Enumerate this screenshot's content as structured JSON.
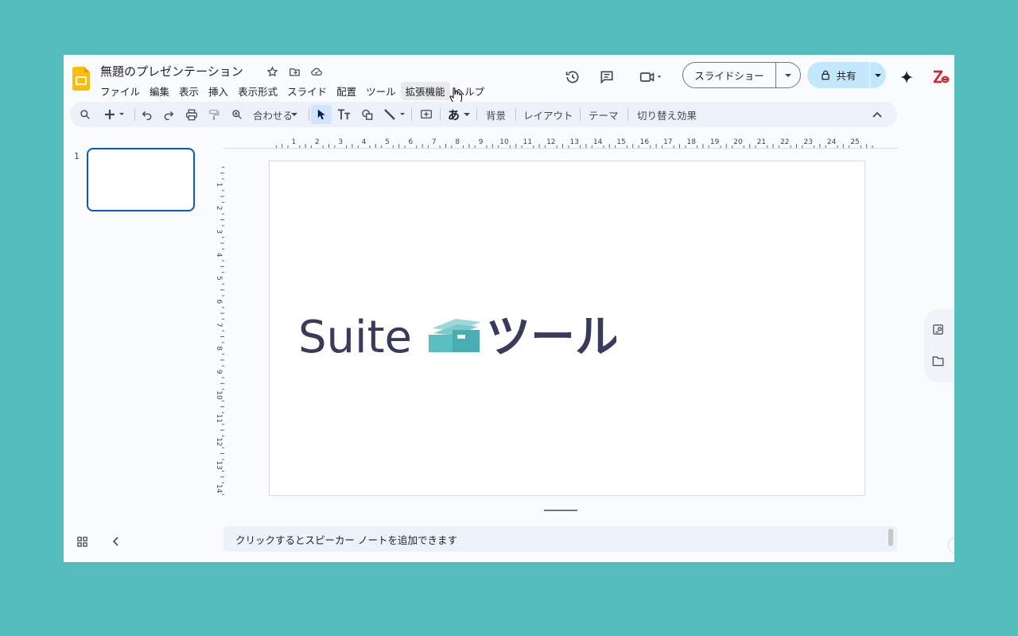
{
  "document": {
    "title": "無題のプレゼンテーション"
  },
  "menu": [
    "ファイル",
    "編集",
    "表示",
    "挿入",
    "表示形式",
    "スライド",
    "配置",
    "ツール",
    "拡張機能",
    "ヘルプ"
  ],
  "header": {
    "slideshow_label": "スライドショー",
    "share_label": "共有"
  },
  "toolbar": {
    "zoom_label": "合わせる",
    "font_input_label": "あ",
    "background_label": "背景",
    "layout_label": "レイアウト",
    "theme_label": "テーマ",
    "transition_label": "切り替え効果"
  },
  "filmstrip": {
    "slide_number": "1"
  },
  "rulers": {
    "horizontal": [
      "1",
      "2",
      "3",
      "4",
      "5",
      "6",
      "7",
      "8",
      "9",
      "10",
      "11",
      "12",
      "13",
      "14",
      "15",
      "16",
      "17",
      "18",
      "19",
      "20",
      "21",
      "22",
      "23",
      "24",
      "25"
    ],
    "vertical": [
      "1",
      "2",
      "3",
      "4",
      "5",
      "6",
      "7",
      "8",
      "9",
      "10",
      "11",
      "12",
      "13",
      "14"
    ]
  },
  "slide": {
    "logo_text_latin": "Suite",
    "logo_text_japanese": "ツール"
  },
  "notes": {
    "placeholder": "クリックするとスピーカー ノートを追加できます"
  },
  "colors": {
    "background": "#56bdbf",
    "logo_dark": "#3a3a5c",
    "logo_teal": "#5bbfc2",
    "share_button": "#c2e7ff",
    "selection_border": "#0b57d0"
  }
}
